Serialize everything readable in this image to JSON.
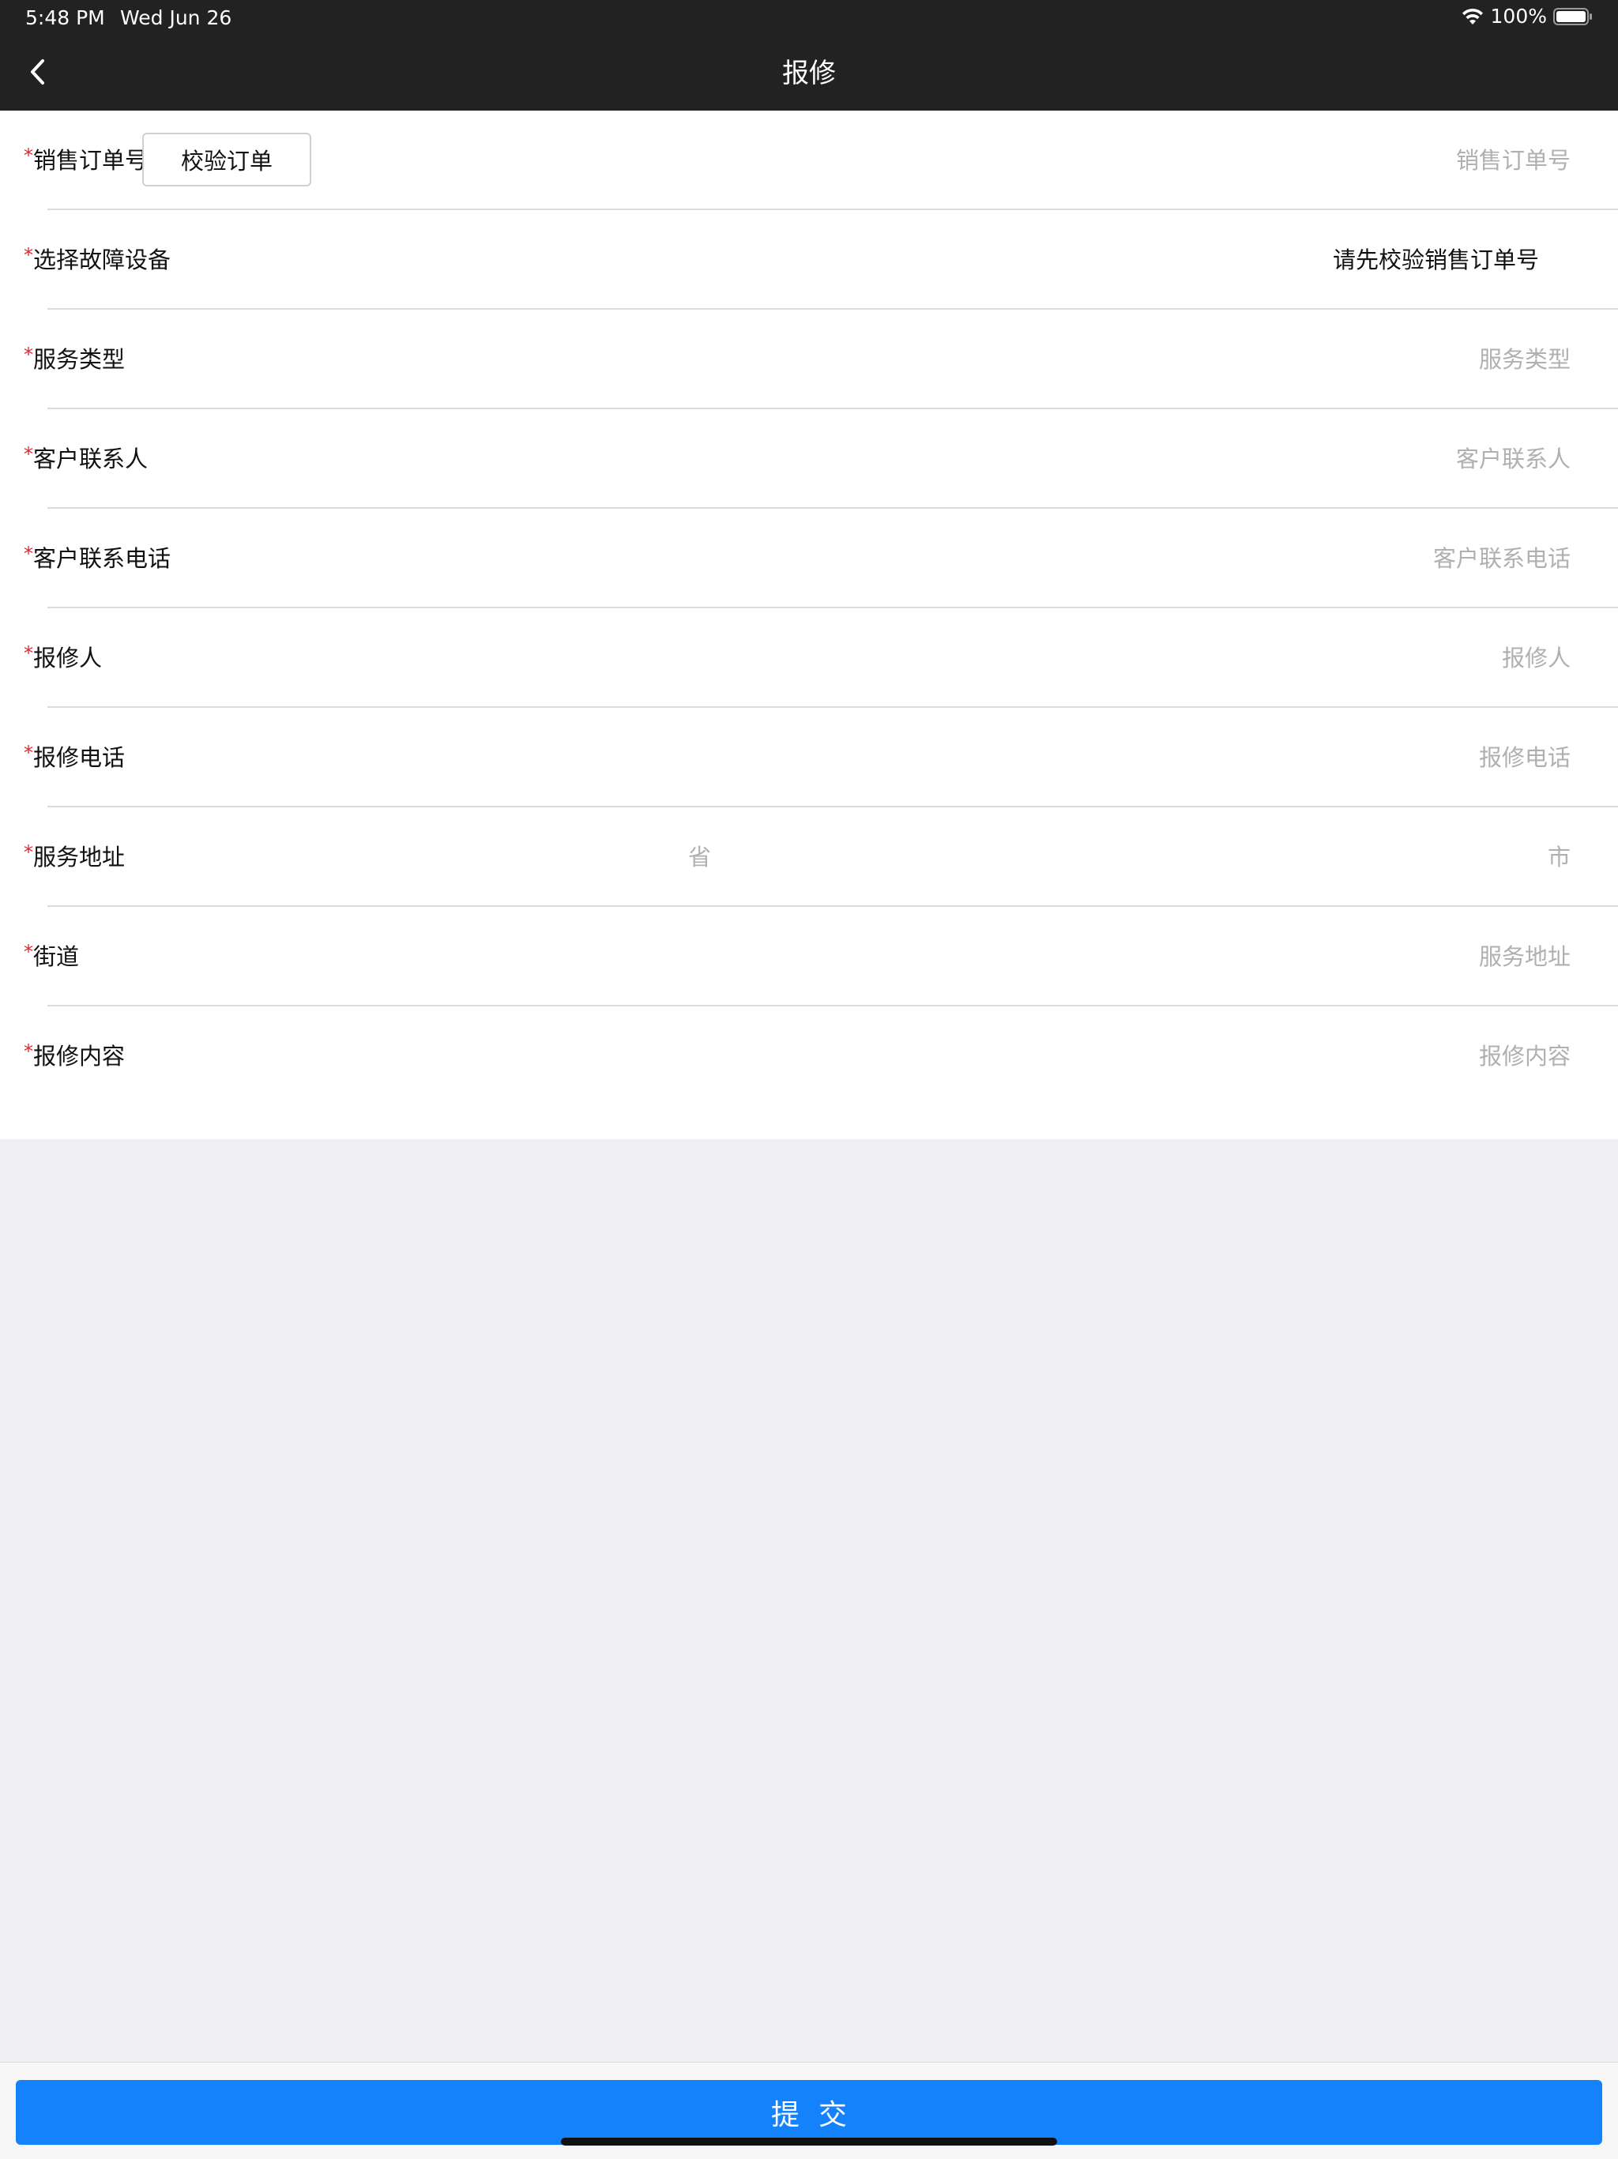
{
  "status_bar": {
    "time": "5:48 PM",
    "date": "Wed Jun 26",
    "battery": "100%"
  },
  "nav": {
    "title": "报修",
    "back_icon": "chevron-left-icon"
  },
  "form": {
    "required_mark": "*",
    "sales_order": {
      "label": "销售订单号",
      "verify_label": "校验订单",
      "placeholder": "销售订单号",
      "value": ""
    },
    "device": {
      "label": "选择故障设备",
      "value": "请先校验销售订单号"
    },
    "service_type": {
      "label": "服务类型",
      "placeholder": "服务类型",
      "value": ""
    },
    "contact_name": {
      "label": "客户联系人",
      "placeholder": "客户联系人",
      "value": ""
    },
    "contact_phone": {
      "label": "客户联系电话",
      "placeholder": "客户联系电话",
      "value": ""
    },
    "reporter": {
      "label": "报修人",
      "placeholder": "报修人",
      "value": ""
    },
    "reporter_phone": {
      "label": "报修电话",
      "placeholder": "报修电话",
      "value": ""
    },
    "address": {
      "label": "服务地址",
      "province_placeholder": "省",
      "city_placeholder": "市"
    },
    "street": {
      "label": "街道",
      "placeholder": "服务地址",
      "value": ""
    },
    "content": {
      "label": "报修内容",
      "placeholder": "报修内容",
      "value": ""
    }
  },
  "submit_label": "提交",
  "colors": {
    "header_bg": "#222222",
    "required": "#e5252c",
    "submit": "#1482fa",
    "background": "#efeff4",
    "placeholder": "#b0b0b0"
  }
}
